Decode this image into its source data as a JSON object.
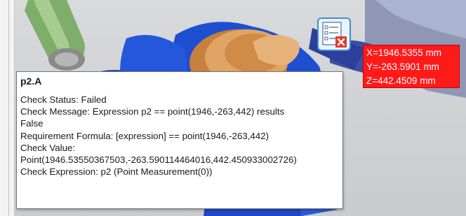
{
  "readout": {
    "x": "X=1946.5355 mm",
    "y": "Y=-263.5901 mm",
    "z": "Z=442.4509 mm"
  },
  "tooltip": {
    "title": "p2.A",
    "lines": [
      "Check Status: Failed",
      "Check Message: Expression p2 == point(1946,-263,442) results",
      "False",
      "Requirement Formula: [expression] == point(1946,-263,442)",
      "Check Value:",
      "Point(1946.53550367503,-263.590114464016,442.450933002726)",
      "Check Expression: p2 (Point Measurement(0))"
    ]
  },
  "icons": {
    "check": "check-failed-icon"
  },
  "colors": {
    "readout_bg": "#ff1a1a",
    "icon_border": "#3d8fd6",
    "model_orange": "#d9944f",
    "model_blue": "#1f4fd1"
  }
}
